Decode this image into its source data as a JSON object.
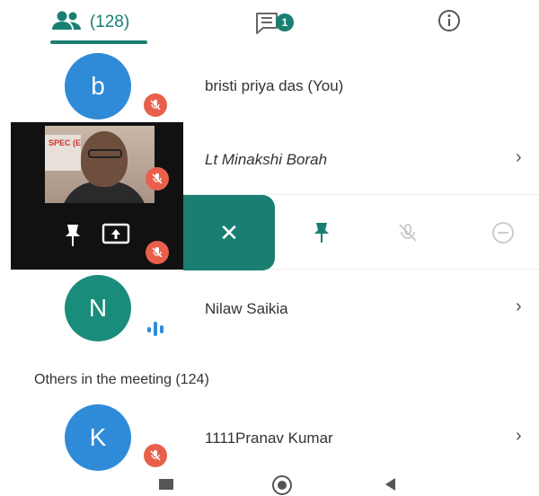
{
  "tabs": {
    "people_count": "(128)",
    "chat_badge": "1"
  },
  "participants": [
    {
      "initial": "b",
      "name": "bristi priya das (You)",
      "avatar_color": "#2f8bd8"
    },
    {
      "name": "Lt Minakshi Borah"
    },
    {
      "initial": "N",
      "name": "Nilaw Saikia",
      "avatar_color": "#1a8c7c"
    }
  ],
  "video_tile": {
    "banner_text": "SPEC (E"
  },
  "action_bar": {
    "close_symbol": "✕"
  },
  "others": {
    "title": "Others in the meeting (124)",
    "items": [
      {
        "initial": "K",
        "name": "1111Pranav Kumar",
        "avatar_color": "#2f8bd8"
      }
    ]
  },
  "chevron": "›",
  "colors": {
    "accent": "#1a7f72",
    "mute_red": "#e8604c",
    "avatar_blue": "#2f8bd8",
    "avatar_teal": "#1a8c7c"
  },
  "icons": {
    "people": "people-icon",
    "chat": "chat-icon",
    "info": "info-icon",
    "mic_off": "mic-off-icon",
    "pin": "pin-icon",
    "present": "present-icon",
    "audio": "audio-level-icon",
    "close": "close-icon"
  }
}
